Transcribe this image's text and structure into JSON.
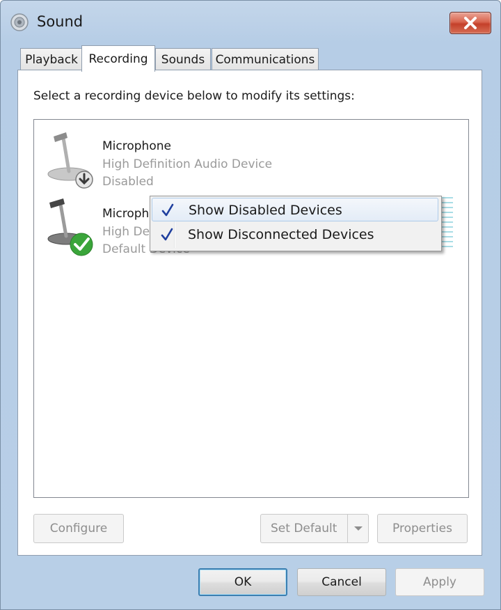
{
  "window": {
    "title": "Sound",
    "close_icon": "close-icon"
  },
  "tabs": [
    {
      "label": "Playback"
    },
    {
      "label": "Recording"
    },
    {
      "label": "Sounds"
    },
    {
      "label": "Communications"
    }
  ],
  "active_tab": "Recording",
  "panel": {
    "instruction": "Select a recording device below to modify its settings:"
  },
  "devices": [
    {
      "name": "Microphone",
      "description": "High Definition Audio Device",
      "status": "Disabled",
      "badge": "disabled-down-arrow-icon"
    },
    {
      "name": "Microphone",
      "description": "High Definition Audio Device",
      "status": "Default Device",
      "badge": "default-checkmark-icon",
      "level_meter_bars": 11
    }
  ],
  "context_menu": {
    "items": [
      {
        "label": "Show Disabled Devices",
        "checked": true
      },
      {
        "label": "Show Disconnected Devices",
        "checked": true
      }
    ]
  },
  "panel_buttons": {
    "configure": "Configure",
    "set_default": "Set Default",
    "properties": "Properties"
  },
  "dialog_buttons": {
    "ok": "OK",
    "cancel": "Cancel",
    "apply": "Apply"
  },
  "colors": {
    "disabled_text": "#9a9a9a",
    "check_mark": "#1f3f9e",
    "default_badge": "#3aa53a",
    "level_meter": "#a9dde6"
  }
}
